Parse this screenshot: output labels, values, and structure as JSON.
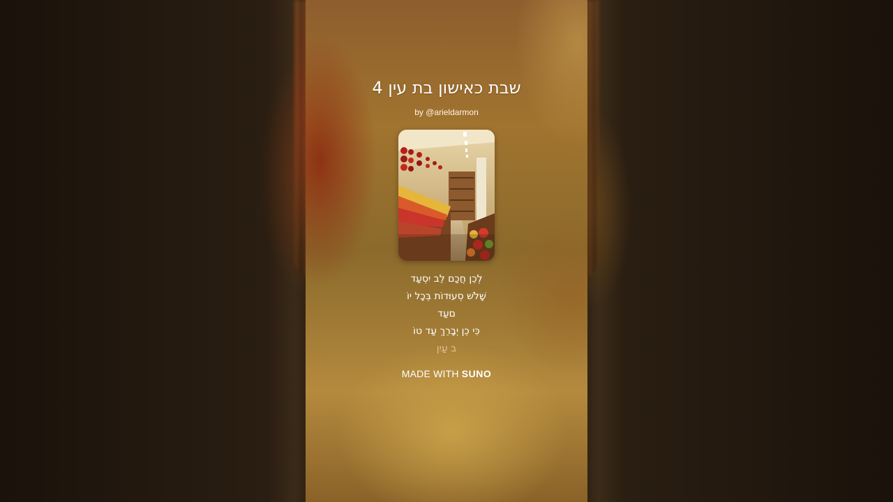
{
  "song": {
    "title": "שבת כאישון בת עין 4",
    "byline": "by @arieldarmon"
  },
  "cover": {
    "icon": "market-produce-aisle-image"
  },
  "lyrics": {
    "lines": [
      "לְכֵן חֲכַם לֵב יִסְעַד",
      "שָׁלֹשׁ סְעוּדוֹת בְּכָל יוֹ",
      "םעַד",
      "כִּי כֵן יְבָרֵךְ עַד טוֹ",
      "ב עַיִן"
    ]
  },
  "footer": {
    "made_with": "MADE WITH",
    "brand": "SUNO"
  },
  "colors": {
    "panel_top": "#8e5d2e",
    "panel_bottom": "#b48a3e",
    "text": "#ffffff"
  }
}
